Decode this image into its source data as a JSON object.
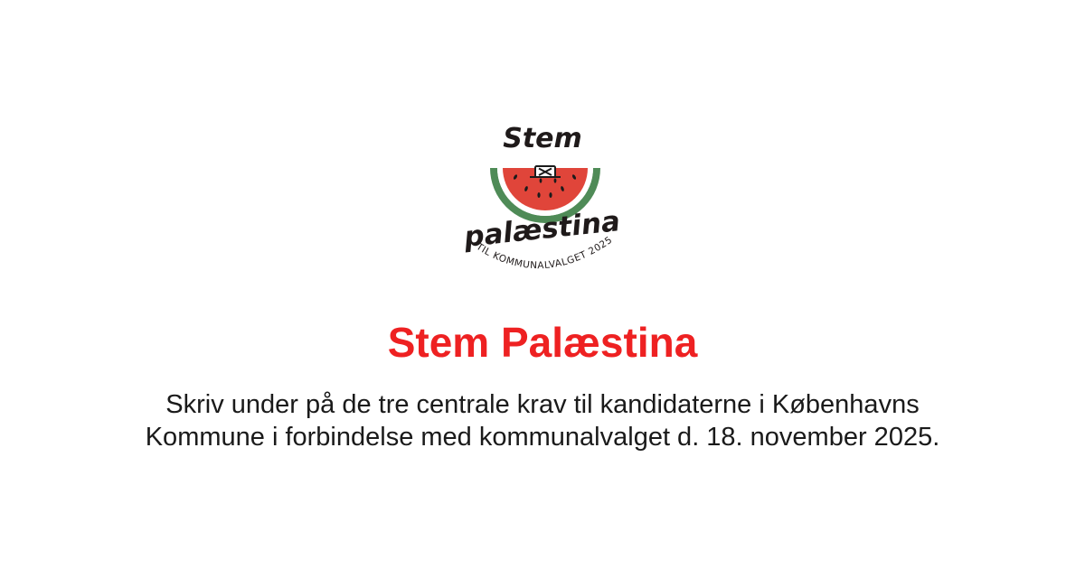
{
  "logo": {
    "word_top": "Stem",
    "word_bottom": "palæstina",
    "arc_text": "TIL KOMMUNALVALGET 2025",
    "icon": "watermelon-ballot-icon",
    "colors": {
      "flesh": "#e0453a",
      "rind": "#4f8b57",
      "seed": "#1b1b1b",
      "ink": "#1f1a1a"
    }
  },
  "title": "Stem Palæstina",
  "description_line1": "Skriv under på de tre centrale krav til kandidaterne i Københavns",
  "description_line2": "Kommune i forbindelse med kommunalvalget d. 18. november 2025.",
  "colors": {
    "title": "#ee2122",
    "text": "#1a1a1a",
    "background": "#ffffff"
  }
}
